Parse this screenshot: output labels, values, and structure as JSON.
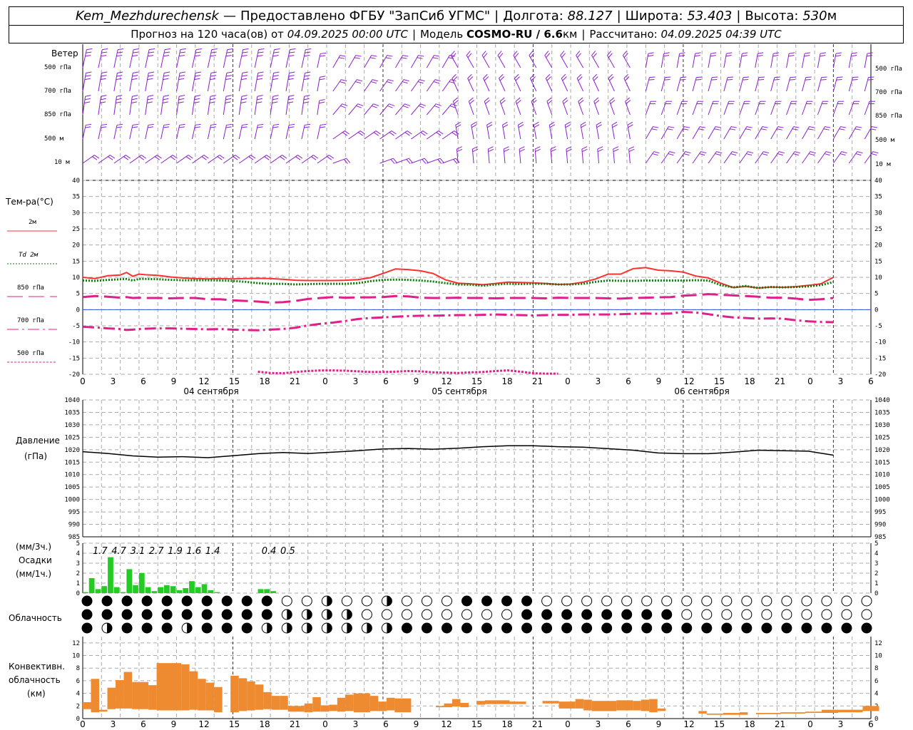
{
  "header": {
    "station": "Kem_Mezhdurechensk",
    "provided_by": "Предоставлено ФГБУ \"ЗапСиб УГМС\"",
    "lon_label": "Долгота:",
    "lon_value": "88.127",
    "lat_label": "Широта:",
    "lat_value": "53.403",
    "alt_label": "Высота:",
    "alt_value": "530",
    "alt_unit": "м",
    "forecast_prefix": "Прогноз на 120 часа(ов) от",
    "forecast_start": "04.09.2025 00:00 UTC",
    "model_label": "Модель",
    "model_name": "COSMO-RU / 6.6",
    "model_unit": "км",
    "computed_label": "Рассчитано:",
    "computed_value": "04.09.2025 04:39 UTC"
  },
  "wind_panel": {
    "title": "Ветер",
    "levels": [
      "500 гПа",
      "700 гПа",
      "850 гПа",
      "500 м",
      "10  м"
    ]
  },
  "temp_panel": {
    "title": "Тем-ра(°С)",
    "legend": [
      {
        "label": "2м",
        "color": "#ff2020",
        "dash": "solid"
      },
      {
        "label": "Td  2м",
        "color": "#0a7a0a",
        "dash": "dotted"
      },
      {
        "label": "850 гПа",
        "color": "#e0208a",
        "dash": "longdash"
      },
      {
        "label": "700 гПа",
        "color": "#e0208a",
        "dash": "dashdot"
      },
      {
        "label": "500 гПа",
        "color": "#e0208a",
        "dash": "dotted"
      }
    ],
    "yticks": [
      "40",
      "35",
      "30",
      "25",
      "20",
      "15",
      "10",
      "5",
      "0",
      "-5",
      "-10",
      "-15",
      "-20"
    ]
  },
  "time_axis": {
    "hours": [
      "0",
      "3",
      "6",
      "9",
      "12",
      "15",
      "18",
      "21",
      "0",
      "3",
      "6",
      "9",
      "12",
      "15",
      "18",
      "21",
      "0",
      "3",
      "6",
      "9",
      "12",
      "15",
      "18",
      "21",
      "0",
      "3",
      "6"
    ],
    "dates": [
      "04 сентября",
      "05 сентября",
      "06 сентября"
    ]
  },
  "pressure_panel": {
    "title": "Давление",
    "unit": "(гПа)",
    "yticks": [
      "1040",
      "1035",
      "1030",
      "1025",
      "1020",
      "1015",
      "1010",
      "1005",
      "1000",
      "995",
      "990",
      "985"
    ]
  },
  "precip_panel": {
    "label_top": "(мм/3ч.)",
    "label_mid": "Осадки",
    "label_bot": "(мм/1ч.)",
    "yticks": [
      "5",
      "4",
      "3",
      "2",
      "1",
      "0"
    ],
    "totals_3h": [
      {
        "hour": 3,
        "value": "1.7"
      },
      {
        "hour": 6,
        "value": "4.7"
      },
      {
        "hour": 9,
        "value": "3.1"
      },
      {
        "hour": 12,
        "value": "2.7"
      },
      {
        "hour": 15,
        "value": "1.9"
      },
      {
        "hour": 18,
        "value": "1.6"
      },
      {
        "hour": 21,
        "value": "1.4"
      },
      {
        "hour": 30,
        "value": "0.4"
      },
      {
        "hour": 33,
        "value": "0.5"
      }
    ]
  },
  "cloud_panel": {
    "title": "Облачность"
  },
  "conv_panel": {
    "label1": "Конвективн.",
    "label2": "облачность",
    "label3": "(км)",
    "yticks": [
      "12",
      "10",
      "8",
      "6",
      "4",
      "2",
      "0"
    ]
  },
  "colors": {
    "wind": "#8a20c8",
    "temp2m": "#ff3030",
    "dew": "#0a7a0a",
    "upper": "#e0208a",
    "pressure": "#000000",
    "precip": "#22cc22",
    "conv": "#ee8a30",
    "zero_line": "#3050e0"
  },
  "chart_data": [
    {
      "type": "line",
      "title": "Тем-ра(°С)",
      "x_unit": "hours from 04.09.2025 00:00 UTC",
      "ylim": [
        -20,
        40
      ],
      "x": [
        0,
        2,
        4,
        6,
        7,
        8,
        9,
        10,
        12,
        14,
        16,
        18,
        20,
        22,
        24,
        26,
        28,
        30,
        32,
        34,
        36,
        38,
        40,
        42,
        44,
        46,
        48,
        50,
        52,
        54,
        56,
        58,
        60,
        62,
        64,
        66,
        68,
        70,
        72,
        74,
        76,
        78,
        80,
        82,
        84,
        86,
        88,
        90,
        92,
        94,
        96,
        98,
        100,
        102,
        104,
        106,
        108,
        110,
        112,
        114,
        116,
        118,
        120
      ],
      "series": [
        {
          "name": "2м",
          "values": [
            10,
            9.6,
            10.5,
            10.7,
            11.5,
            10.3,
            11.0,
            10.8,
            10.6,
            10.1,
            9.8,
            9.6,
            9.5,
            9.6,
            9.5,
            9.6,
            9.7,
            9.6,
            9.4,
            9.1,
            9.0,
            9.0,
            9.0,
            9.1,
            9.3,
            9.9,
            11.2,
            12.6,
            12.4,
            12.0,
            11.2,
            9.2,
            8.2,
            8.0,
            7.7,
            8.1,
            8.5,
            8.4,
            8.3,
            8.1,
            7.8,
            7.9,
            8.5,
            9.5,
            11.0,
            11.0,
            12.7,
            13.0,
            12.2,
            12.0,
            11.6,
            10.4,
            9.8,
            8.2,
            6.8,
            7.2,
            6.7,
            7.0,
            6.9,
            7.1,
            7.5,
            8.0,
            10
          ]
        },
        {
          "name": "Td  2м",
          "values": [
            9,
            8.9,
            9.2,
            9.4,
            9.5,
            9.0,
            9.5,
            9.5,
            9.4,
            9.2,
            9.1,
            9.1,
            9.1,
            9.0,
            8.9,
            8.6,
            8.2,
            8.0,
            8.0,
            7.8,
            7.9,
            8.0,
            8.0,
            8.0,
            8.2,
            8.8,
            9.2,
            9.3,
            9.2,
            9.0,
            8.7,
            8.2,
            7.8,
            7.7,
            7.4,
            7.8,
            8.0,
            7.9,
            8.0,
            8.0,
            7.8,
            7.8,
            8.0,
            8.6,
            9.0,
            8.9,
            8.9,
            9.0,
            9.0,
            9.0,
            9.0,
            9.1,
            9.0,
            7.6,
            6.9,
            7.3,
            6.7,
            7.0,
            6.9,
            7.0,
            7.2,
            7.6,
            8.5
          ]
        },
        {
          "name": "850 гПа",
          "values": [
            3.9,
            4.2,
            4.0,
            3.7,
            3.9,
            3.6,
            3.7,
            3.6,
            3.6,
            3.5,
            3.6,
            3.6,
            3.2,
            3.2,
            2.9,
            2.7,
            2.5,
            2.2,
            2.3,
            2.7,
            3.3,
            3.6,
            3.9,
            3.7,
            3.8,
            3.8,
            3.9,
            4.2,
            4.1,
            3.7,
            3.6,
            3.6,
            3.7,
            3.6,
            3.6,
            3.5,
            3.6,
            3.6,
            3.6,
            3.5,
            3.7,
            3.6,
            3.6,
            3.6,
            3.5,
            3.4,
            3.6,
            3.7,
            3.8,
            3.9,
            4.3,
            4.5,
            4.8,
            4.6,
            4.4,
            4.2,
            4.0,
            3.7,
            3.7,
            3.4,
            3.0,
            3.2,
            3.6
          ]
        },
        {
          "name": "700 гПа",
          "values": [
            -5.3,
            -5.5,
            -5.8,
            -6.0,
            -6.3,
            -6.2,
            -6.0,
            -5.9,
            -5.8,
            -5.8,
            -5.9,
            -6.0,
            -6.1,
            -6.0,
            -6.2,
            -6.3,
            -6.4,
            -6.2,
            -6.0,
            -5.6,
            -4.9,
            -4.4,
            -4.0,
            -3.5,
            -2.9,
            -2.6,
            -2.4,
            -2.2,
            -2.0,
            -1.9,
            -1.9,
            -1.8,
            -1.7,
            -1.7,
            -1.6,
            -1.5,
            -1.6,
            -1.7,
            -1.8,
            -1.7,
            -1.6,
            -1.6,
            -1.5,
            -1.5,
            -1.5,
            -1.4,
            -1.3,
            -1.2,
            -1.3,
            -1.2,
            -0.7,
            -0.9,
            -1.4,
            -2.0,
            -2.4,
            -2.6,
            -2.8,
            -2.7,
            -2.8,
            -3.3,
            -3.6,
            -3.8,
            -3.9
          ]
        },
        {
          "name": "500 гПа",
          "values": [
            null,
            null,
            null,
            null,
            null,
            null,
            null,
            null,
            null,
            null,
            null,
            null,
            null,
            null,
            null,
            null,
            -19.2,
            -19.6,
            -19.7,
            -19.3,
            -19.0,
            -18.8,
            -18.8,
            -18.9,
            -19.1,
            -19.3,
            -19.3,
            -19.2,
            -19.0,
            -19.1,
            -19.4,
            -19.5,
            -19.6,
            -19.4,
            -19.3,
            -19.0,
            -18.8,
            -19.2,
            -19.7,
            -19.8,
            -19.8,
            null,
            null,
            null,
            null,
            null,
            null,
            null,
            null,
            null,
            null,
            null,
            null,
            null,
            null,
            null,
            null,
            null,
            null,
            null,
            null,
            null,
            null
          ]
        }
      ]
    },
    {
      "type": "line",
      "title": "Давление",
      "ylabel": "(гПа)",
      "ylim": [
        985,
        1040
      ],
      "x": [
        0,
        4,
        8,
        12,
        16,
        20,
        24,
        28,
        32,
        36,
        40,
        44,
        48,
        52,
        56,
        60,
        64,
        68,
        72,
        76,
        80,
        84,
        88,
        92,
        96,
        100,
        104,
        108,
        112,
        116,
        120
      ],
      "series": [
        {
          "values": [
            1019.2,
            1018.5,
            1017.5,
            1017.0,
            1017.2,
            1016.8,
            1017.6,
            1018.4,
            1018.9,
            1018.5,
            1019.0,
            1019.6,
            1020.3,
            1020.5,
            1020.2,
            1020.6,
            1021.2,
            1021.6,
            1021.6,
            1021.2,
            1021.0,
            1020.4,
            1019.8,
            1018.7,
            1018.4,
            1018.4,
            1019.0,
            1019.8,
            1019.6,
            1019.4,
            1017.8
          ]
        }
      ]
    },
    {
      "type": "bar",
      "title": "Осадки",
      "ylabel": "(мм/1ч.)",
      "ylim": [
        0,
        5
      ],
      "x": [
        1,
        2,
        3,
        4,
        5,
        6,
        7,
        8,
        9,
        10,
        11,
        12,
        13,
        14,
        15,
        16,
        17,
        18,
        19,
        20,
        21,
        22,
        29,
        30,
        31
      ],
      "values": [
        0.1,
        1.5,
        0.4,
        0.7,
        3.6,
        0.6,
        0.1,
        2.4,
        0.8,
        2.0,
        0.6,
        0.2,
        0.6,
        0.8,
        0.7,
        0.3,
        0.5,
        1.2,
        0.6,
        0.9,
        0.3,
        0.1,
        0.4,
        0.4,
        0.2
      ]
    },
    {
      "type": "bar",
      "title": "Конвективн. облачность",
      "ylabel": "(км)",
      "ylim": [
        0,
        13
      ],
      "bars": [
        {
          "from": 0,
          "to": 1,
          "low": 1.5,
          "high": 2.6
        },
        {
          "from": 1,
          "to": 2,
          "low": 1.0,
          "high": 6.3
        },
        {
          "from": 2,
          "to": 3,
          "low": 1.1,
          "high": 1.4
        },
        {
          "from": 3,
          "to": 4,
          "low": 1.5,
          "high": 4.9
        },
        {
          "from": 4,
          "to": 5,
          "low": 1.6,
          "high": 6.1
        },
        {
          "from": 5,
          "to": 6,
          "low": 1.6,
          "high": 7.4
        },
        {
          "from": 6,
          "to": 8,
          "low": 1.5,
          "high": 5.8
        },
        {
          "from": 8,
          "to": 9,
          "low": 1.4,
          "high": 5.3
        },
        {
          "from": 9,
          "to": 12,
          "low": 1.3,
          "high": 8.8
        },
        {
          "from": 12,
          "to": 13,
          "low": 1.3,
          "high": 8.6
        },
        {
          "from": 13,
          "to": 14,
          "low": 1.4,
          "high": 7.5
        },
        {
          "from": 14,
          "to": 15,
          "low": 1.3,
          "high": 6.3
        },
        {
          "from": 15,
          "to": 16,
          "low": 1.3,
          "high": 5.7
        },
        {
          "from": 16,
          "to": 17,
          "low": 1.0,
          "high": 5.0
        },
        {
          "from": 18,
          "to": 19,
          "low": 1.0,
          "high": 6.8
        },
        {
          "from": 19,
          "to": 20,
          "low": 1.2,
          "high": 6.4
        },
        {
          "from": 20,
          "to": 21,
          "low": 1.3,
          "high": 5.9
        },
        {
          "from": 21,
          "to": 22,
          "low": 1.4,
          "high": 5.4
        },
        {
          "from": 22,
          "to": 23,
          "low": 1.5,
          "high": 4.2
        },
        {
          "from": 23,
          "to": 24,
          "low": 1.4,
          "high": 3.6
        },
        {
          "from": 24,
          "to": 25,
          "low": 1.4,
          "high": 3.6
        },
        {
          "from": 25,
          "to": 27,
          "low": 1.1,
          "high": 2.0
        },
        {
          "from": 27,
          "to": 28,
          "low": 1.0,
          "high": 2.4
        },
        {
          "from": 28,
          "to": 29,
          "low": 1.1,
          "high": 3.4
        },
        {
          "from": 29,
          "to": 30,
          "low": 1.1,
          "high": 2.1
        },
        {
          "from": 30,
          "to": 31,
          "low": 1.2,
          "high": 2.2
        },
        {
          "from": 31,
          "to": 32,
          "low": 1.1,
          "high": 3.3
        },
        {
          "from": 32,
          "to": 33,
          "low": 1.2,
          "high": 3.8
        },
        {
          "from": 33,
          "to": 35,
          "low": 1.0,
          "high": 4.0
        },
        {
          "from": 35,
          "to": 36,
          "low": 1.2,
          "high": 3.6
        },
        {
          "from": 36,
          "to": 37,
          "low": 1.2,
          "high": 2.7
        },
        {
          "from": 37,
          "to": 38,
          "low": 1.3,
          "high": 3.3
        },
        {
          "from": 38,
          "to": 40,
          "low": 1.0,
          "high": 3.2
        },
        {
          "from": 43,
          "to": 44,
          "low": 1.8,
          "high": 2.0
        },
        {
          "from": 44,
          "to": 45,
          "low": 1.8,
          "high": 2.4
        },
        {
          "from": 45,
          "to": 46,
          "low": 1.9,
          "high": 3.1
        },
        {
          "from": 46,
          "to": 47,
          "low": 1.8,
          "high": 2.5
        },
        {
          "from": 48,
          "to": 49,
          "low": 2.2,
          "high": 2.8
        },
        {
          "from": 49,
          "to": 52,
          "low": 2.3,
          "high": 2.9
        },
        {
          "from": 52,
          "to": 54,
          "low": 2.3,
          "high": 2.7
        },
        {
          "from": 56,
          "to": 58,
          "low": 2.4,
          "high": 2.8
        },
        {
          "from": 58,
          "to": 60,
          "low": 1.6,
          "high": 2.7
        },
        {
          "from": 60,
          "to": 61,
          "low": 1.6,
          "high": 3.1
        },
        {
          "from": 61,
          "to": 62,
          "low": 1.3,
          "high": 3.0
        },
        {
          "from": 62,
          "to": 65,
          "low": 1.2,
          "high": 2.8
        },
        {
          "from": 65,
          "to": 67,
          "low": 1.3,
          "high": 2.9
        },
        {
          "from": 67,
          "to": 68,
          "low": 1.3,
          "high": 2.8
        },
        {
          "from": 68,
          "to": 69,
          "low": 1.2,
          "high": 3.0
        },
        {
          "from": 69,
          "to": 70,
          "low": 1.0,
          "high": 3.1
        },
        {
          "from": 70,
          "to": 71,
          "low": 1.2,
          "high": 1.6
        },
        {
          "from": 75,
          "to": 76,
          "low": 0.8,
          "high": 1.2
        },
        {
          "from": 76,
          "to": 78,
          "low": 0.6,
          "high": 0.8
        },
        {
          "from": 78,
          "to": 80,
          "low": 0.6,
          "high": 0.9
        },
        {
          "from": 80,
          "to": 81,
          "low": 0.6,
          "high": 1.0
        },
        {
          "from": 82,
          "to": 85,
          "low": 0.7,
          "high": 0.9
        },
        {
          "from": 85,
          "to": 88,
          "low": 0.8,
          "high": 1.0
        },
        {
          "from": 88,
          "to": 90,
          "low": 0.9,
          "high": 1.1
        },
        {
          "from": 90,
          "to": 92,
          "low": 0.9,
          "high": 1.4
        },
        {
          "from": 92,
          "to": 95,
          "low": 1.0,
          "high": 1.4
        },
        {
          "from": 95,
          "to": 97,
          "low": 1.2,
          "high": 2.0
        }
      ]
    }
  ]
}
